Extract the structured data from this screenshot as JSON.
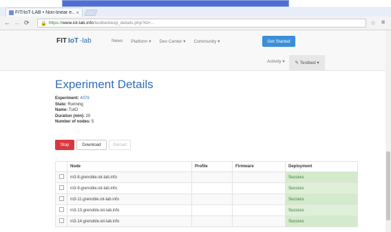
{
  "browser": {
    "tab_title": "FIT/IoT-LAB • Non-linear e...",
    "tab_close": "×",
    "url_scheme": "https://",
    "url_host": "www.iot-lab.info",
    "url_path": "/testbed/exp_details.php?id=..."
  },
  "navbar": {
    "brand_fit": "FIT",
    "brand_iot": "IoT",
    "brand_lab": "-lab",
    "links": [
      "News",
      "Platform ▾",
      "Dev Center ▾",
      "Community ▾"
    ],
    "cta": "Get Started"
  },
  "subnav": {
    "activity": "Activity ▾",
    "testbed": "Testbed ▾"
  },
  "experiment": {
    "title": "Experiment Details",
    "fields": [
      {
        "label": "Experiment:",
        "value": "4079"
      },
      {
        "label": "State:",
        "value": "Running"
      },
      {
        "label": "Name:",
        "value": "TutO"
      },
      {
        "label": "Duration (min):",
        "value": "20"
      },
      {
        "label": "Number of nodes:",
        "value": "5"
      }
    ]
  },
  "actions": {
    "stop": "Stop",
    "download": "Download",
    "reload": "Reload"
  },
  "nodes_table": {
    "headers": [
      "Node",
      "Profile",
      "Firmware",
      "Deployment"
    ],
    "rows": [
      {
        "node": "m3-8.grenoble.iot-lab.info",
        "profile": "",
        "firmware": "",
        "deployment": "Success"
      },
      {
        "node": "m3-9.grenoble.iot-lab.info",
        "profile": "",
        "firmware": "",
        "deployment": "Success"
      },
      {
        "node": "m3-11.grenoble.iot-lab.info",
        "profile": "",
        "firmware": "",
        "deployment": "Success"
      },
      {
        "node": "m3-13.grenoble.iot-lab.info",
        "profile": "",
        "firmware": "",
        "deployment": "Success"
      },
      {
        "node": "m3-14.grenoble.iot-lab.info",
        "profile": "",
        "firmware": "",
        "deployment": "Success"
      }
    ]
  },
  "colors": {
    "brand": "#2f6dba",
    "danger": "#d9373e",
    "success_bg": "#dff0d8",
    "cta": "#3a8fd8"
  }
}
